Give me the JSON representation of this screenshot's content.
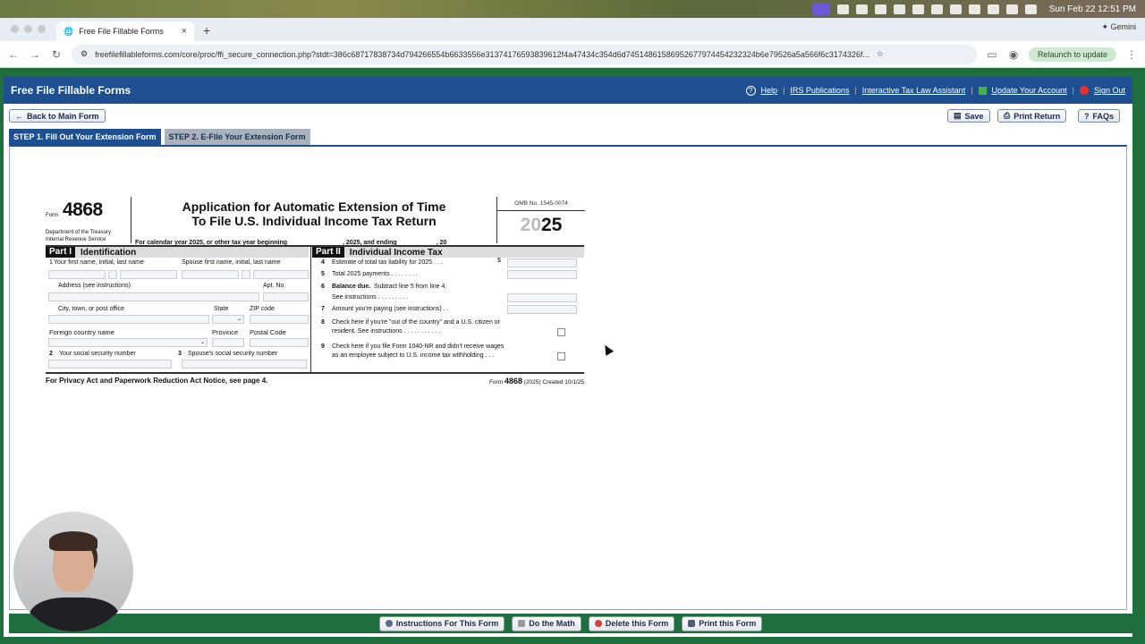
{
  "menubar": {
    "datetime": "Sun Feb 22  12:51 PM"
  },
  "browser": {
    "tab_title": "Free File Fillable Forms",
    "url": "freefilefillableforms.com/core/proc/ffi_secure_connection.php?stdt=386c68717838734d794266554b6633556e31374176593839612f4a47434c354d6d74514861586952677974454232324b6e79526a5a566f6c3174326f...",
    "relaunch_label": "Relaunch to update",
    "gemini_label": "Gemini"
  },
  "header": {
    "brand": "Free File Fillable Forms",
    "help": "Help",
    "irs_publications": "IRS Publications",
    "tax_law_assistant": "Interactive Tax Law Assistant",
    "update_account": "Update Your Account",
    "sign_out": "Sign Out"
  },
  "toolbar": {
    "back": "Back to Main Form",
    "save": "Save",
    "print_return": "Print Return",
    "faqs": "FAQs"
  },
  "steps": [
    {
      "label": "STEP 1. Fill Out Your Extension Form"
    },
    {
      "label": "STEP 2. E-File Your Extension Form"
    }
  ],
  "form": {
    "form_word": "Form",
    "form_number": "4868",
    "department": "Department of the Treasury",
    "irs": "Internal Revenue Service",
    "title_line1": "Application for Automatic Extension of Time",
    "title_line2": "To File U.S. Individual Income Tax Return",
    "cal_year": "For calendar year 2025, or other tax year beginning",
    "cal_and_ending": ", 2025, and ending",
    "cal_twenty": ", 20",
    "omb": "OMB No. 1545-0074",
    "year_light": "20",
    "year_bold": "25",
    "part1_label": "Part I",
    "part1_title": "Identification",
    "part2_label": "Part II",
    "part2_title": "Individual Income Tax",
    "l1_label": "Your first name, initial, last name",
    "l1_num": "1",
    "spouse_label": "Spouse first name, initial, last name",
    "address_label": "Address (see instructions)",
    "apt_label": "Apt. No.",
    "city_label": "City, town, or post office",
    "state_label": "State",
    "zip_label": "ZIP code",
    "foreign_label": "Foreign country name",
    "province_label": "Province",
    "postal_label": "Postal Code",
    "l2_num": "2",
    "l2_label": "Your social security number",
    "l3_num": "3",
    "l3_label": "Spouse's social security number",
    "l4_num": "4",
    "l4_label": "Estimate of total tax liability for 2025 . . .",
    "dollar": "$",
    "l5_num": "5",
    "l5_label": "Total 2025 payments . . . . . . . .",
    "l6_num": "6",
    "l6_label_bold": "Balance due.",
    "l6_label": "Subtract line 5 from line 4.",
    "l6_label2": "See instructions . . . . . . . . .",
    "l7_num": "7",
    "l7_label": "Amount you're paying (see instructions) . .",
    "l8_num": "8",
    "l8_label": "Check here if you're \"out of the country\" and a U.S. citizen or",
    "l8_label2": "resident. See instructions . . . . . . . . . . .",
    "l9_num": "9",
    "l9_label": "Check here if you file Form 1040-NR and didn't receive wages",
    "l9_label2": "as an employee subject to U.S. income tax withholding . . .",
    "privacy": "For Privacy Act and Paperwork Reduction Act Notice, see page 4.",
    "footer_form": "Form",
    "footer_no": "4868",
    "footer_rest": "(2025) Created 10/1/25"
  },
  "bottom_buttons": {
    "instructions": "Instructions For This Form",
    "do_math": "Do the Math",
    "delete": "Delete this Form",
    "print_form": "Print this Form"
  },
  "colors": {
    "header_blue": "#1d4f91",
    "frame_green": "#1e6e3e",
    "relaunch_green": "#cfe8d2"
  }
}
